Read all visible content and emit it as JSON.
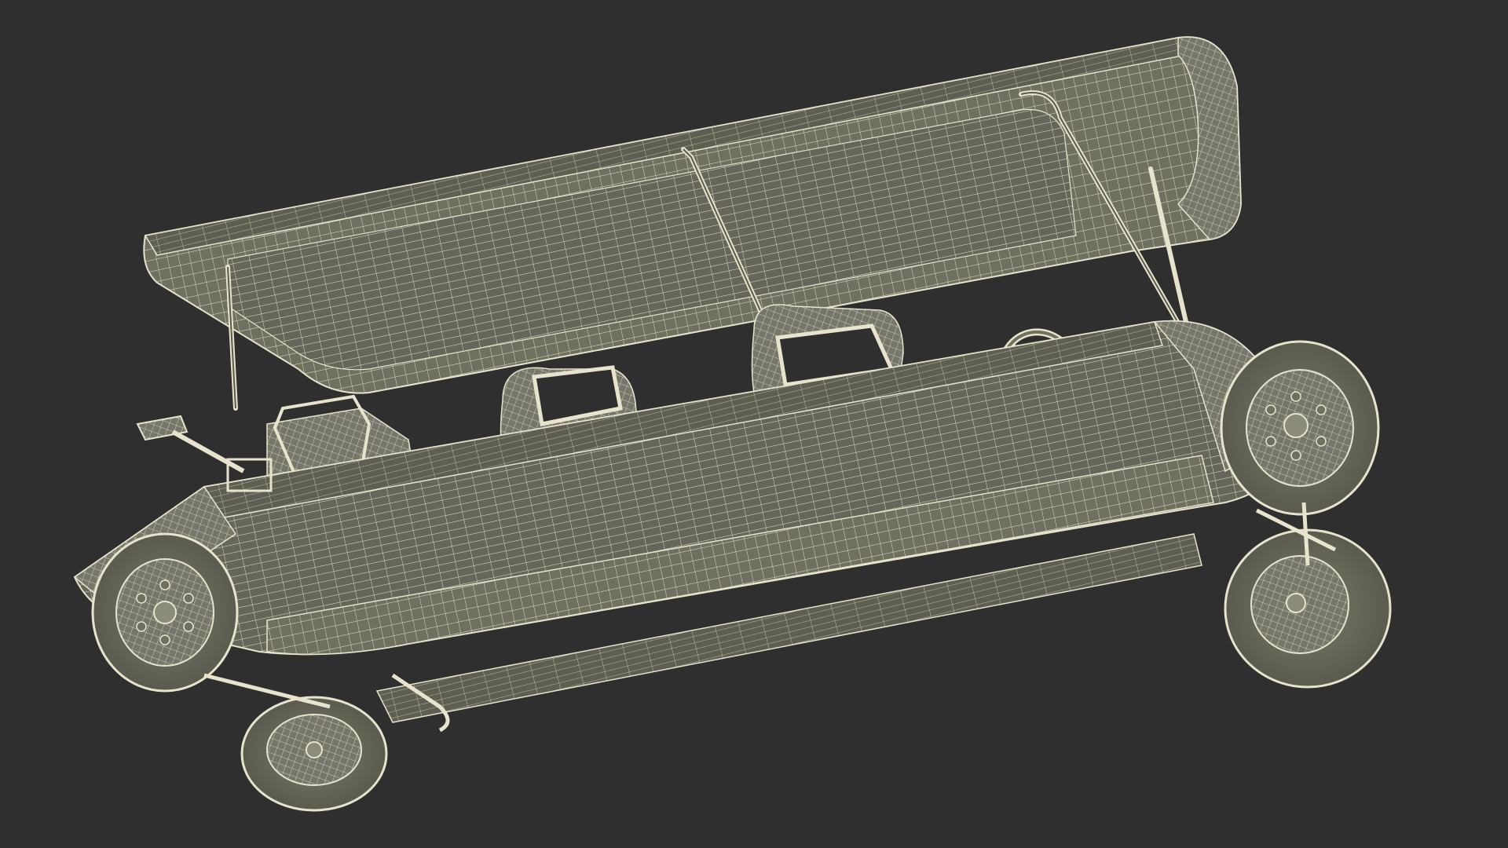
{
  "scene": {
    "subject": "wireframe-golf-cart-model",
    "colors": {
      "background": "#2f2f2f",
      "surface": "#6f705f",
      "surface_dark": "#5a5b4d",
      "surface_light": "#8a8b78",
      "wire": "#e7e3cc",
      "wire_dim": "#b9b6a1"
    }
  }
}
